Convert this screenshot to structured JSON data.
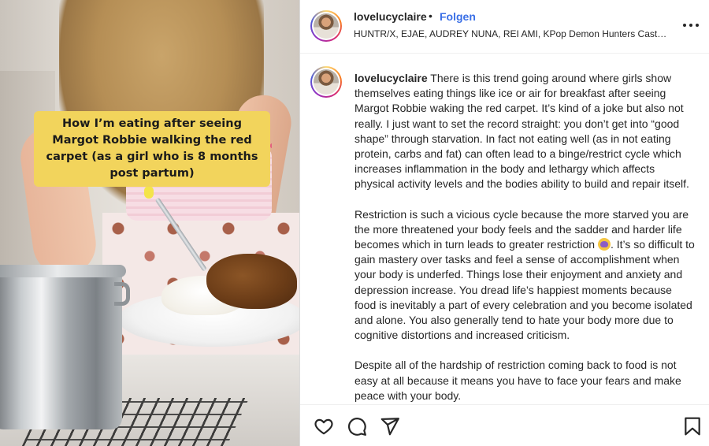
{
  "media": {
    "caption": "How I’m eating after seeing Margot Robbie walking the red carpet (as a girl who is 8 months post partum)"
  },
  "post": {
    "username": "lovelucyclaire",
    "separator": "•",
    "follow_label": "Folgen",
    "audio": "HUNTR/X, EJAE, AUDREY NUNA, REI AMI, KPop Demon Hunters Cast…"
  },
  "comment": {
    "username": "lovelucyclaire",
    "paragraph1": "There is this trend going around where girls show themselves eating things like ice or air for breakfast after seeing Margot Robbie waking the red carpet. It’s kind of a joke but also not really. I just want to set the record straight: you don’t get into “good shape” through starvation. In fact not eating well (as in not eating protein, carbs and fat) can often lead to a binge/restrict cycle which increases inflammation in the body and lethargy which affects physical activity levels and the bodies ability to build and repair itself.",
    "paragraph2_a": "Restriction is such a vicious cycle because the more starved you are the more threatened your body feels and the sadder and harder life becomes which in turn leads to greater restriction",
    "paragraph2_b": ". It’s so difficult to gain mastery over tasks and feel a sense of accomplishment when your body is underfed. Things lose their enjoyment and anxiety and depression increase. You dread life’s happiest moments because food is inevitably a part of every celebration and you become isolated and alone. You also generally tend to hate your body more due to cognitive distortions and increased criticism.",
    "paragraph3": "Despite all of the hardship of restriction coming back to food is not easy at all because it means you have to face your fears and make peace with your body."
  },
  "icons": {
    "more": "more-options-icon",
    "like": "heart-icon",
    "comment": "comment-icon",
    "share": "send-icon",
    "save": "bookmark-icon",
    "emoji": "face-emoji-icon"
  },
  "colors": {
    "follow": "#3a6fe6",
    "caption_bg": "#f2d45c",
    "text": "#262626"
  }
}
